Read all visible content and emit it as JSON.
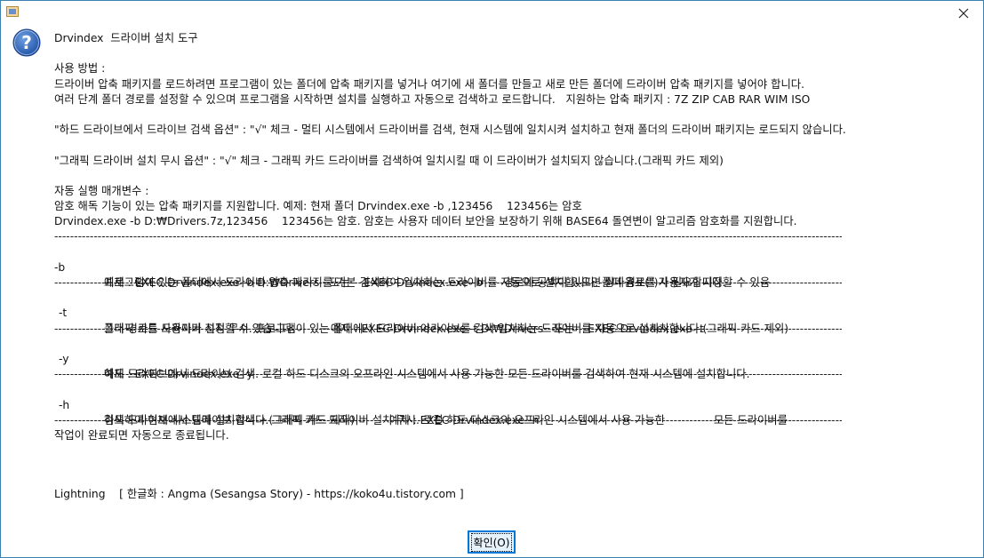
{
  "titlebar": {
    "icon": "app-icon",
    "close_icon": "close-icon"
  },
  "dialog": {
    "question_icon": "question-icon",
    "title": "Drvindex  드라이버 설치 도구",
    "usage_heading": "사용 방법 :",
    "usage_1": "드라이버 압축 패키지를 로드하려면 프로그램이 있는 폴더에 압축 패키지를 넣거나 여기에 새 폴더를 만들고 새로 만든 폴더에 드라이버 압축 패키지를 넣어야 합니다.",
    "usage_2": "여러 단계 폴더 경로를 설정할 수 있으며 프로그램을 시작하면 설치를 실행하고 자동으로 검색하고 로드합니다.   지원하는 압축 패키지 : 7Z ZIP CAB RAR WIM ISO",
    "hdd_option": "\"하드 드라이브에서 드라이브 검색 옵션\" : \"√\" 체크 - 멀티 시스템에서 드라이버를 검색, 현재 시스템에 일치시켜 설치하고 현재 폴더의 드라이버 패키지는 로드되지 않습니다.",
    "gpu_option": "\"그래픽 드라이버 설치 무시 옵션\" : \"√\" 체크 - 그래픽 카드 드라이버를 검색하여 일치시킬 때 이 드라이버가 설치되지 않습니다.(그래픽 카드 제외)",
    "params_heading": "자동 실행 매개변수 :",
    "params_1": "암호 해독 기능이 있는 압축 패키지를 지원합니다. 예제: 현재 폴더 Drvindex.exe -b ,123456    123456는 암호",
    "params_2": "Drvindex.exe -b D:₩Drivers.7z,123456    123456는 암호. 암호는 사용자 데이터 보안을 보장하기 위해 BASE64 돌연변이 알고리즘 암호화를 지원합니다.",
    "separator": "-------------------------------------------------------------------------------------------------------------------------------------------------------------------------------------------------------------------------",
    "options": [
      {
        "flag": "-b",
        "line1": "프로그램이 있는 폴더에서 드라이버 압축 패키지를 기본 검색하여 일치하는 드라이버를 자동으로 설치합니다. 폴더 경로를 사용자가 지정할 수 있음",
        "line2": "예제 : EXEC Drvindex.exe -b D:₩Drivers   또는    EXEC Drvindex.exe -b      경로에 공백이 있으면 쌍따옴표(\")가 필요합니다."
      },
      {
        "flag": "-t",
        "line1": "그래픽 카드 드라이버 설치 무시. 프로그램이 있는 폴더에서 드라이버 아카이브를 검색 일치하는 드라이버를 자동으로 설치치합니다.(그래픽 카드 제외)",
        "line2": "폴더 경로를 사용자가 지정할 수 있습니다.          예제 : EXEC Drvindex.exe -t D:₩Drivers   또는    EXEC Drvindex.exe -t"
      },
      {
        "flag": "-y",
        "line1": "하드 드라이브에서 드라이브 검색. 로컬 하드 디스크의 오프라인 시스템에서 사용 가능한 모든 드라이버를 검색하여 현재 시스템에 설치합니다.",
        "line2": "예제 : EXEC Drvindex.exe -y"
      },
      {
        "flag": "-h",
        "line1": "하드 드라이브에서 드라이브 검색 + 그래픽 카드 드라이버 설치 무시. 로컬 하드 디스크의 오프라인 시스템에서 사용 가능한              모든 드라이버를",
        "line2": "검색하여 현재 시스템에 설치합니다.(그래픽 카드 제외)          예제 : EXEC Drvindex.exe -h"
      }
    ],
    "completion": "작업이 완료되면 자동으로 종료됩니다.",
    "credits": "Lightning    [ 한글화 : Angma (Sesangsa Story) - https://koko4u.tistory.com ]",
    "ok_label": "확인(O)"
  }
}
